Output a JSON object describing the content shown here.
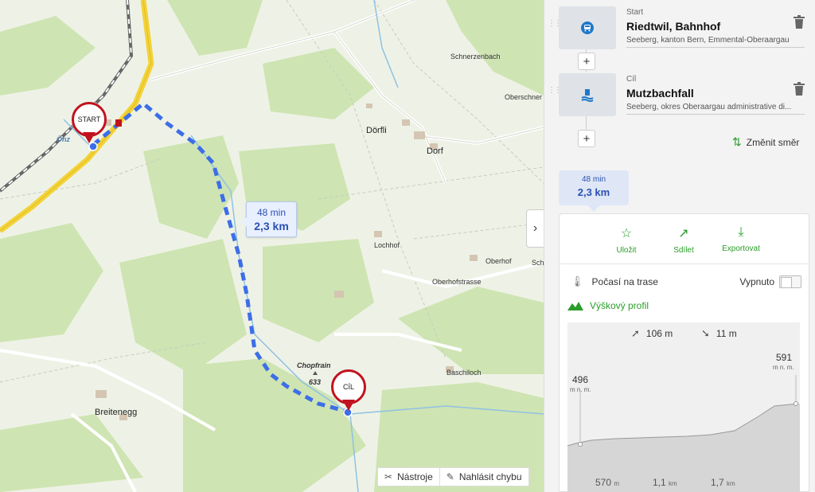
{
  "map": {
    "places": {
      "schnerzenbach": "Schnerzenbach",
      "oberschnerz": "Oberschner",
      "dorfli": "Dörfli",
      "dorf": "Dorf",
      "lochhof": "Lochhof",
      "oberhof": "Oberhof",
      "oberhofstrasse": "Oberhofstrasse",
      "chopfrain": "Chopfrain",
      "chopfrain_height": "633",
      "baschiloch": "Baschiloch",
      "breitenegg": "Breitenegg",
      "osz": "Önz",
      "schedge": "Sch"
    },
    "start_marker": "START",
    "end_marker": "CÍL",
    "route_label": {
      "time": "48 min",
      "distance": "2,3 km"
    },
    "tools": {
      "tools_label": "Nástroje",
      "report_label": "Nahlásit chybu"
    },
    "colors": {
      "route": "#3d6ee8",
      "marker": "#c1121f",
      "forest": "#c9e2a9",
      "water": "#8fc1e3"
    }
  },
  "panel": {
    "start": {
      "kind": "Start",
      "name": "Riedtwil, Bahnhof",
      "desc": "Seeberg, kanton Bern, Emmental-Oberaargau",
      "icon": "train-station-icon"
    },
    "end": {
      "kind": "Cíl",
      "name": "Mutzbachfall",
      "desc": "Seeberg, okres Oberaargau administrative di...",
      "icon": "waterfall-icon"
    },
    "add_label": "+",
    "reverse_label": "Změnit směr",
    "variant": {
      "time": "48 min",
      "distance": "2,3 km"
    },
    "actions": {
      "save": "Uložit",
      "share": "Sdílet",
      "export": "Exportovat"
    },
    "weather": {
      "label": "Počasí na trase",
      "state": "Vypnuto"
    },
    "elevation": {
      "title": "Výškový profil",
      "ascent": "106 m",
      "descent": "11 m",
      "start_elev": "496",
      "end_elev": "591",
      "unit": "m n. m.",
      "ticks": [
        {
          "value": "570",
          "unit": "m"
        },
        {
          "value": "1,1",
          "unit": "km"
        },
        {
          "value": "1,7",
          "unit": "km"
        }
      ]
    },
    "accent": "#2a9d2a"
  }
}
